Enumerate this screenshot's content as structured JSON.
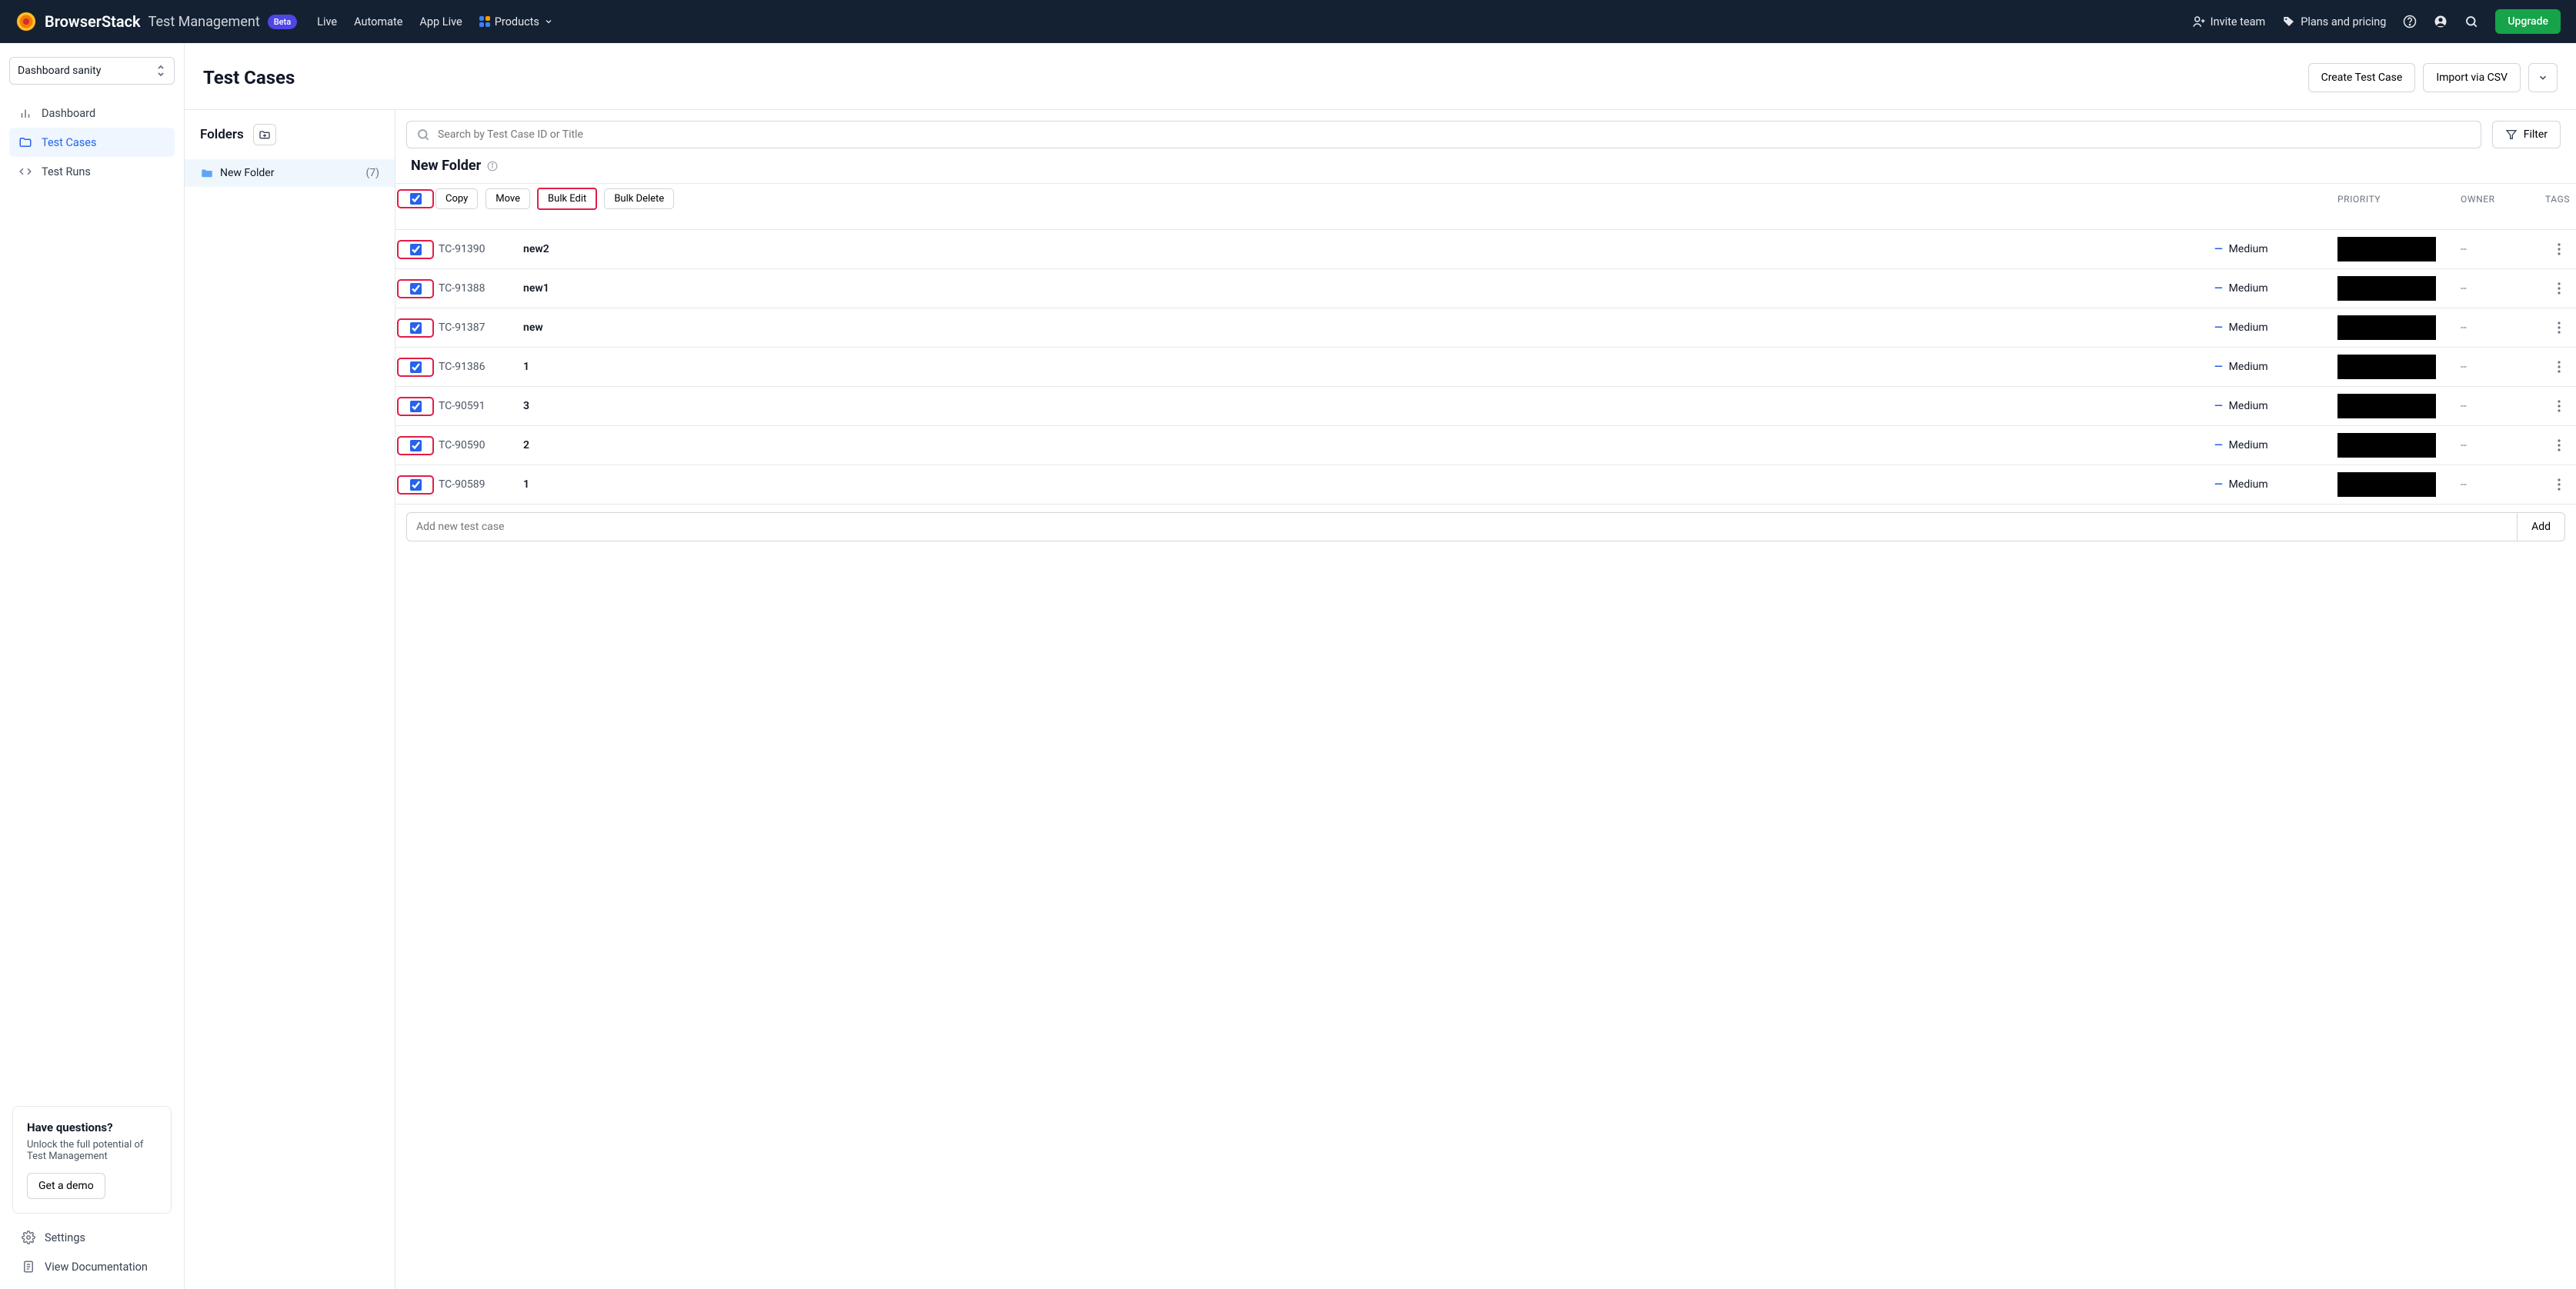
{
  "nav": {
    "brand": "BrowserStack",
    "subbrand": "Test Management",
    "beta": "Beta",
    "primary": [
      "Live",
      "Automate",
      "App Live"
    ],
    "products": "Products",
    "invite": "Invite team",
    "plans": "Plans and pricing",
    "upgrade": "Upgrade"
  },
  "project": "Dashboard sanity",
  "sidebar": {
    "items": [
      {
        "label": "Dashboard"
      },
      {
        "label": "Test Cases"
      },
      {
        "label": "Test Runs"
      }
    ],
    "help": {
      "title": "Have questions?",
      "body": "Unlock the full potential of Test Management",
      "cta": "Get a demo"
    },
    "bottom": [
      {
        "label": "Settings"
      },
      {
        "label": "View Documentation"
      }
    ]
  },
  "page": {
    "title": "Test Cases",
    "create": "Create Test Case",
    "import": "Import via CSV"
  },
  "folders": {
    "heading": "Folders",
    "list": [
      {
        "name": "New Folder",
        "count": "(7)"
      }
    ]
  },
  "search_placeholder": "Search by Test Case ID or Title",
  "filter_label": "Filter",
  "current_folder": "New Folder",
  "bulk_actions": {
    "copy": "Copy",
    "move": "Move",
    "bulk_edit": "Bulk Edit",
    "bulk_delete": "Bulk Delete"
  },
  "columns": {
    "priority": "PRIORITY",
    "owner": "OWNER",
    "tags": "TAGS"
  },
  "rows": [
    {
      "id": "TC-91390",
      "title": "new2",
      "priority": "Medium",
      "tags": "--"
    },
    {
      "id": "TC-91388",
      "title": "new1",
      "priority": "Medium",
      "tags": "--"
    },
    {
      "id": "TC-91387",
      "title": "new",
      "priority": "Medium",
      "tags": "--"
    },
    {
      "id": "TC-91386",
      "title": "1",
      "priority": "Medium",
      "tags": "--"
    },
    {
      "id": "TC-90591",
      "title": "3",
      "priority": "Medium",
      "tags": "--"
    },
    {
      "id": "TC-90590",
      "title": "2",
      "priority": "Medium",
      "tags": "--"
    },
    {
      "id": "TC-90589",
      "title": "1",
      "priority": "Medium",
      "tags": "--"
    }
  ],
  "add_row": {
    "placeholder": "Add new test case",
    "button": "Add"
  }
}
